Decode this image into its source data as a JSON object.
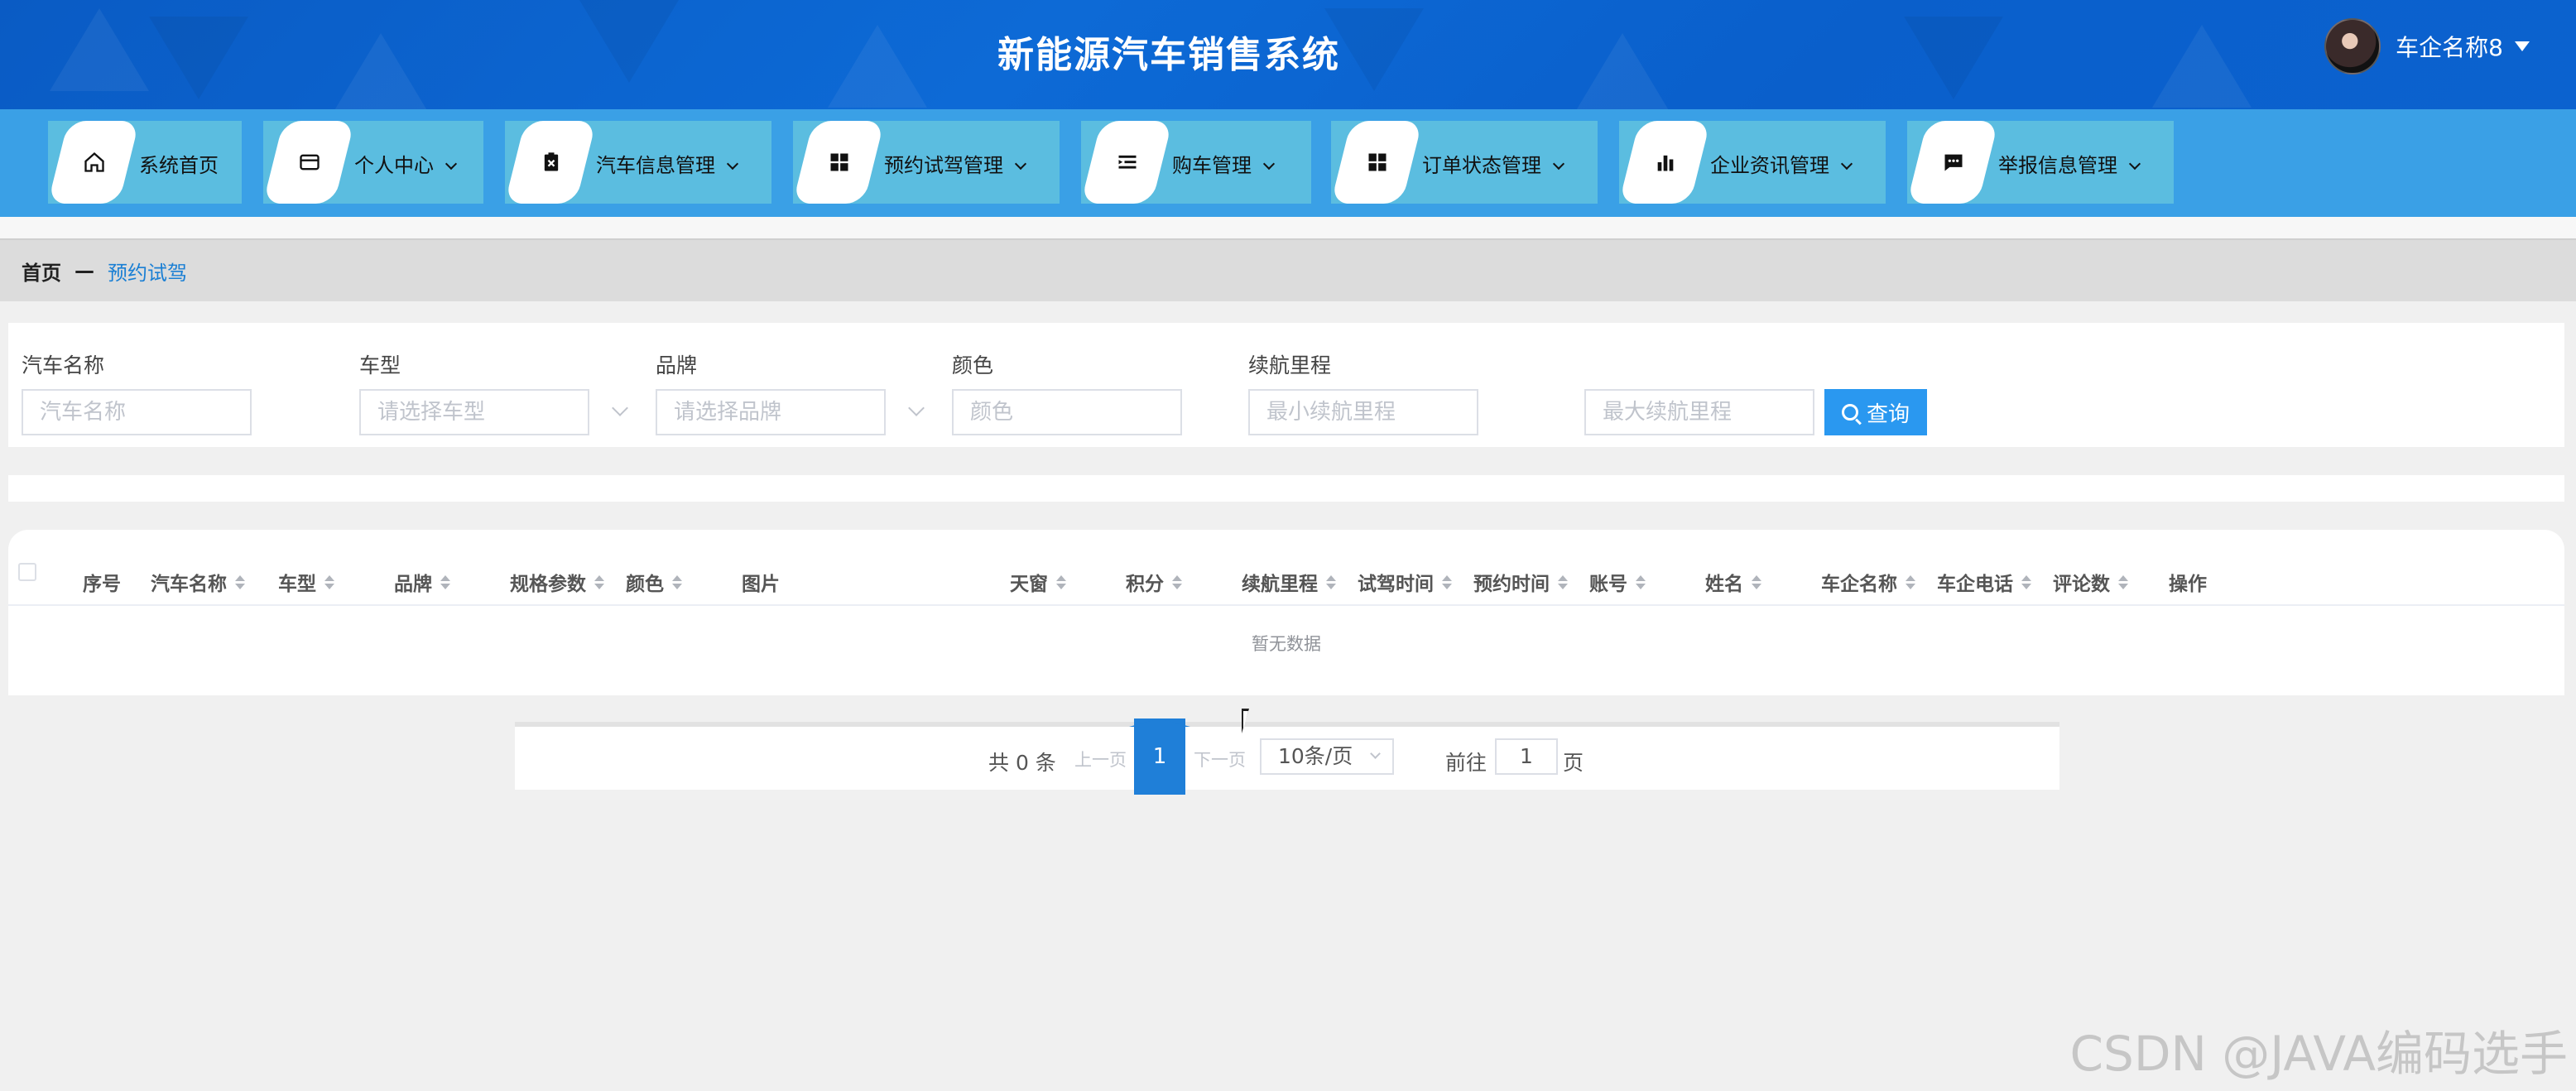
{
  "header": {
    "title": "新能源汽车销售系统",
    "user_name": "车企名称8"
  },
  "nav": [
    {
      "label": "系统首页",
      "icon": "home-icon"
    },
    {
      "label": "个人中心",
      "icon": "wallet-icon"
    },
    {
      "label": "汽车信息管理",
      "icon": "clipboard-x-icon"
    },
    {
      "label": "预约试驾管理",
      "icon": "grid-icon"
    },
    {
      "label": "购车管理",
      "icon": "list-indent-icon"
    },
    {
      "label": "订单状态管理",
      "icon": "grid-icon"
    },
    {
      "label": "企业资讯管理",
      "icon": "bar-chart-icon"
    },
    {
      "label": "举报信息管理",
      "icon": "chat-icon"
    }
  ],
  "breadcrumb": {
    "home": "首页",
    "separator": "—",
    "current": "预约试驾"
  },
  "search": {
    "car_name": {
      "label": "汽车名称",
      "placeholder": "汽车名称"
    },
    "car_type": {
      "label": "车型",
      "placeholder": "请选择车型"
    },
    "brand": {
      "label": "品牌",
      "placeholder": "请选择品牌"
    },
    "color": {
      "label": "颜色",
      "placeholder": "颜色"
    },
    "range": {
      "label": "续航里程",
      "placeholder_min": "最小续航里程",
      "placeholder_max": "最大续航里程"
    },
    "query_label": "查询"
  },
  "table": {
    "columns": [
      "序号",
      "汽车名称",
      "车型",
      "品牌",
      "规格参数",
      "颜色",
      "图片",
      "天窗",
      "积分",
      "续航里程",
      "试驾时间",
      "预约时间",
      "账号",
      "姓名",
      "车企名称",
      "车企电话",
      "评论数",
      "操作"
    ],
    "empty_text": "暂无数据"
  },
  "pagination": {
    "total": "共 0 条",
    "prev": "上一页",
    "current_page": "1",
    "next": "下一页",
    "page_size": "10条/页",
    "goto_label": "前往",
    "goto_value": "1",
    "page_suffix": "页"
  },
  "watermark": "CSDN @JAVA编码选手",
  "colors": {
    "header": "#0a5bc4",
    "nav": "#3aa0e6",
    "nav_item": "#5bbde0",
    "primary": "#2a98f0",
    "breadcrumb_current": "#1a7fd4"
  }
}
